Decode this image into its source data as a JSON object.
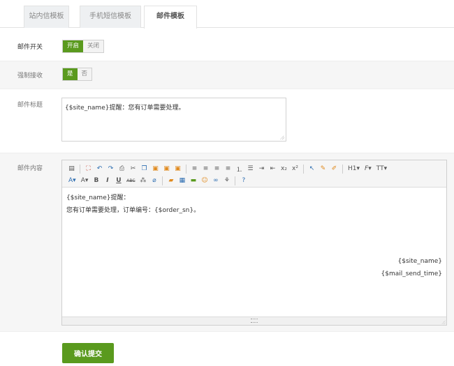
{
  "tabs": [
    {
      "label": "站内信模板",
      "active": false
    },
    {
      "label": "手机短信模板",
      "active": false
    },
    {
      "label": "邮件模板",
      "active": true
    }
  ],
  "mail_switch": {
    "label": "邮件开关",
    "on_label": "开启",
    "off_label": "关闭",
    "value": "on"
  },
  "force_receive": {
    "label": "强制接收",
    "yes_label": "是",
    "no_label": "否",
    "value": "yes"
  },
  "mail_title": {
    "label": "邮件标题",
    "value": "{$site_name}提醒：您有订单需要处理。"
  },
  "mail_content": {
    "label": "邮件内容",
    "lines": [
      "{$site_name}提醒：",
      "您有订单需要处理，订单编号：{$order_sn}。"
    ],
    "right_lines": [
      "{$site_name}",
      "{$mail_send_time}"
    ]
  },
  "toolbar": {
    "h1_label": "H1",
    "font_label": "F",
    "size_label": "TT",
    "font_color_label": "A",
    "bg_color_label": "A",
    "bold_label": "B",
    "italic_label": "I",
    "underline_label": "U",
    "strike_label": "ABC"
  },
  "submit_label": "确认提交",
  "colors": {
    "accent": "#5a9a1e"
  }
}
